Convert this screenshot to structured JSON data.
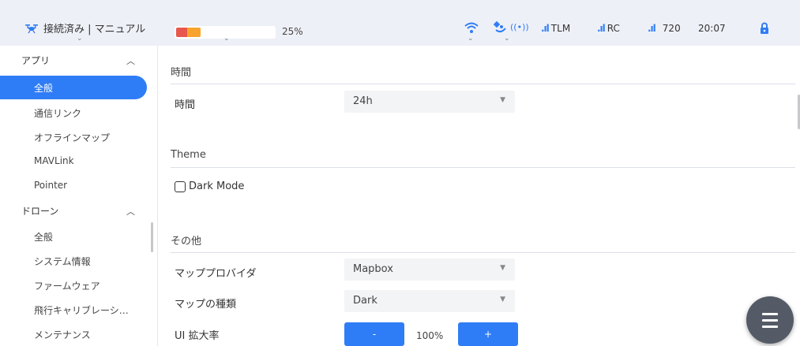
{
  "topbar": {
    "status_text": "接続済み | マニュアル",
    "battery_percent": "25%",
    "battery_level": 0.25,
    "tlm_label": "TLM",
    "rc_label": "RC",
    "signal_value": "720",
    "time": "20:07",
    "icons": [
      "drone-icon",
      "wifi-icon",
      "satellite-icon",
      "signal-bars-icon",
      "lock-icon"
    ]
  },
  "sidebar": {
    "groups": [
      {
        "label": "アプリ",
        "items": [
          "全般",
          "通信リンク",
          "オフラインマップ",
          "MAVLink",
          "Pointer"
        ]
      },
      {
        "label": "ドローン",
        "items": [
          "全般",
          "システム情報",
          "ファームウェア",
          "飛行キャリブレーシ…",
          "メンテナンス"
        ]
      }
    ]
  },
  "main": {
    "sections": [
      {
        "title": "時間"
      },
      {
        "title": "Theme"
      },
      {
        "title": "その他"
      }
    ],
    "time_label": "時間",
    "time_value": "24h",
    "dark_mode_label": "Dark Mode",
    "map_provider_label": "マッププロバイダ",
    "map_provider_value": "Mapbox",
    "map_type_label": "マップの種類",
    "map_type_value": "Dark",
    "ui_scale_label": "UI 拡大率",
    "ui_scale_minus": "-",
    "ui_scale_value": "100%",
    "ui_scale_plus": "+"
  },
  "colors": {
    "accent": "#2f7df6",
    "topbar_bg": "#eef0f7",
    "battery_red": "#e8574d",
    "battery_orange": "#f7a32e"
  }
}
